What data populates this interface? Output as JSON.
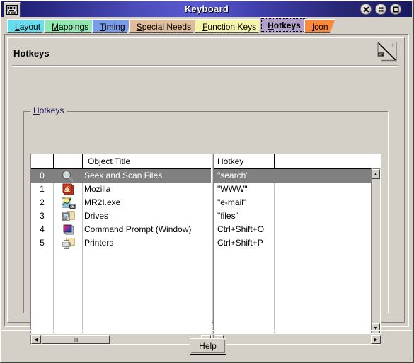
{
  "window": {
    "title": "Keyboard",
    "icon": "keyboard-icon",
    "buttons": [
      {
        "name": "close-button",
        "glyph": "✕"
      },
      {
        "name": "hide-button",
        "glyph": "∷"
      },
      {
        "name": "maximize-button",
        "glyph": "□"
      }
    ]
  },
  "tabs": [
    {
      "label": "Layout",
      "accel": "L",
      "color": "#66ddee",
      "selected": false
    },
    {
      "label": "Mappings",
      "accel": "M",
      "color": "#90e8b0",
      "selected": false
    },
    {
      "label": "Timing",
      "accel": "T",
      "color": "#7a9ce8",
      "selected": false
    },
    {
      "label": "Special Needs",
      "accel": "S",
      "color": "#e0bd9a",
      "selected": false
    },
    {
      "label": "Function Keys",
      "accel": "F",
      "color": "#f6f4a8",
      "selected": false
    },
    {
      "label": "Hotkeys",
      "accel": "H",
      "color": "#b0a0c8",
      "selected": true
    },
    {
      "label": "Icon",
      "accel": "I",
      "color": "#f98a3c",
      "selected": false
    }
  ],
  "page": {
    "title": "Hotkeys",
    "corner_icon": "resize-page-icon"
  },
  "group": {
    "label": "Hotkeys",
    "accel": "H"
  },
  "list": {
    "columns": [
      {
        "key": "index",
        "label": ""
      },
      {
        "key": "icon",
        "label": ""
      },
      {
        "key": "title",
        "label": "Object Title"
      },
      {
        "key": "hotkey",
        "label": "Hotkey"
      },
      {
        "key": "extra",
        "label": ""
      }
    ],
    "rows": [
      {
        "index": "0",
        "icon": "magnifier-icon",
        "title": "Seek and Scan Files",
        "hotkey": "\"search\"",
        "selected": true
      },
      {
        "index": "1",
        "icon": "mozilla-icon",
        "title": "Mozilla",
        "hotkey": "\"WWW\"",
        "selected": false
      },
      {
        "index": "2",
        "icon": "mr2i-exe-icon",
        "title": "MR2I.exe",
        "hotkey": "\"e-mail\"",
        "selected": false
      },
      {
        "index": "3",
        "icon": "drives-icon",
        "title": "Drives",
        "hotkey": "\"files\"",
        "selected": false
      },
      {
        "index": "4",
        "icon": "command-prompt-icon",
        "title": "Command Prompt (Window)",
        "hotkey": "Ctrl+Shift+O",
        "selected": false
      },
      {
        "index": "5",
        "icon": "printers-icon",
        "title": "Printers",
        "hotkey": "Ctrl+Shift+P",
        "selected": false
      }
    ]
  },
  "scrollbars": {
    "left_h": {
      "left_arrow": "◀",
      "right_arrow": "▶",
      "grip": "‖‖"
    },
    "right_h": {
      "left_arrow": "◀",
      "right_arrow": "▶"
    },
    "right_v": {
      "up_arrow": "▲",
      "down_arrow": "▼"
    }
  },
  "footer": {
    "help_label": "Help",
    "help_accel": "H"
  },
  "colors": {
    "face": "#d4d0c8",
    "selection": "#808080",
    "title_blue": "#4a4ab8",
    "group_label": "#181850"
  }
}
